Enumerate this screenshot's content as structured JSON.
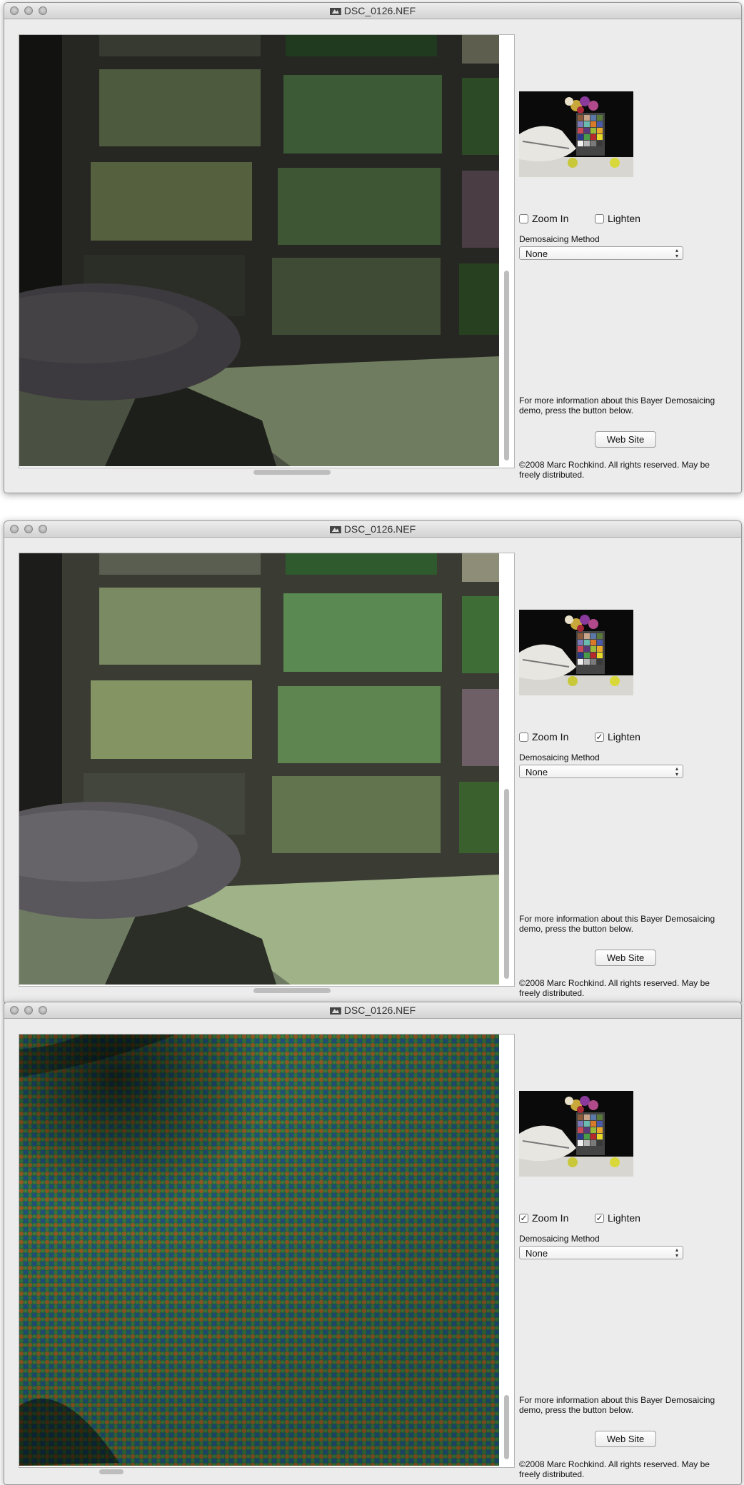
{
  "windows": [
    {
      "title": "DSC_0126.NEF",
      "zoom_in": {
        "label": "Zoom In",
        "checked": false
      },
      "lighten": {
        "label": "Lighten",
        "checked": false
      },
      "demosaicing_label": "Demosaicing Method",
      "method": "None",
      "info_text": "For more information about this Bayer Demosaicing demo, press the button below.",
      "web_button": "Web Site",
      "copyright": "©2008 Marc Rochkind. All rights reserved. May be freely distributed."
    },
    {
      "title": "DSC_0126.NEF",
      "zoom_in": {
        "label": "Zoom In",
        "checked": false
      },
      "lighten": {
        "label": "Lighten",
        "checked": true
      },
      "demosaicing_label": "Demosaicing Method",
      "method": "None",
      "info_text": "For more information about this Bayer Demosaicing demo, press the button below.",
      "web_button": "Web Site",
      "copyright": "©2008 Marc Rochkind. All rights reserved. May be freely distributed."
    },
    {
      "title": "DSC_0126.NEF",
      "zoom_in": {
        "label": "Zoom In",
        "checked": true
      },
      "lighten": {
        "label": "Lighten",
        "checked": true
      },
      "demosaicing_label": "Demosaicing Method",
      "method": "None",
      "info_text": "For more information about this Bayer Demosaicing demo, press the button below.",
      "web_button": "Web Site",
      "copyright": "©2008 Marc Rochkind. All rights reserved. May be freely distributed."
    }
  ]
}
